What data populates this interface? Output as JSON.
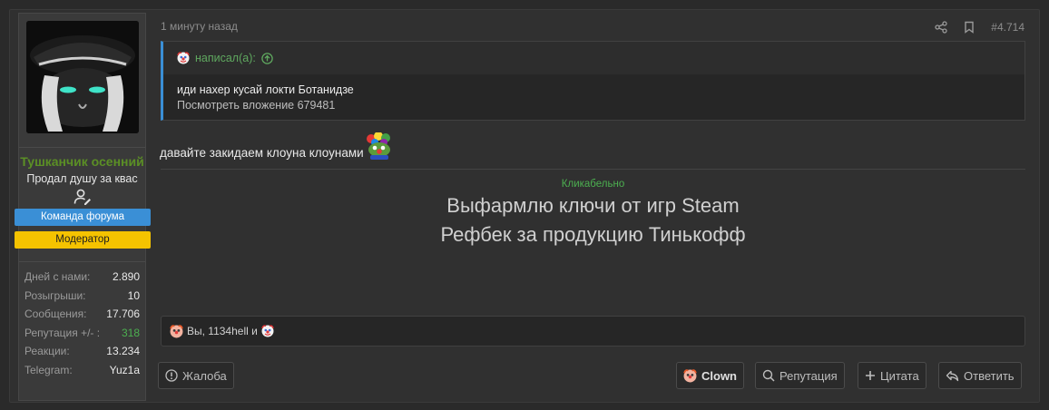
{
  "user": {
    "name": "Тушканчик осенний",
    "title": "Продал душу за квас",
    "banners": {
      "team": "Команда форума",
      "moderator": "Модератор"
    },
    "stats": [
      {
        "label": "Дней с нами:",
        "value": "2.890"
      },
      {
        "label": "Розыгрыши:",
        "value": "10"
      },
      {
        "label": "Сообщения:",
        "value": "17.706"
      },
      {
        "label": "Репутация +/- :",
        "value": "318"
      },
      {
        "label": "Реакции:",
        "value": "13.234"
      },
      {
        "label": "Telegram:",
        "value": "Yuz1a"
      }
    ]
  },
  "post": {
    "timestamp": "1 минуту назад",
    "number": "#4.714",
    "quote": {
      "author_label": "написал(а):",
      "text": "иди нахер кусай локти Ботанидзе",
      "attachment": "Посмотреть вложение 679481"
    },
    "message": "давайте закидаем клоуна клоунами",
    "clickable_note": "Кликабельно",
    "promo_line_1": "Выфармлю ключи от игр Steam",
    "promo_line_2": "Рефбек за продукцию Тинькофф",
    "reactions_text": "Вы, 1134hell и"
  },
  "buttons": {
    "report": "Жалоба",
    "clown": "Clown",
    "reputation": "Репутация",
    "quote": "Цитата",
    "reply": "Ответить"
  },
  "colors": {
    "accent_blue": "#3a8fd6",
    "mod_yellow": "#f5c300",
    "username_green": "#5b8f25",
    "positive_green": "#4caf50"
  },
  "icons": [
    "share-icon",
    "bookmark-icon",
    "arrow-up-circle-icon",
    "user-edit-icon",
    "warning-icon",
    "search-icon",
    "plus-icon",
    "reply-icon",
    "clown-icon",
    "pepe-clown-icon"
  ]
}
